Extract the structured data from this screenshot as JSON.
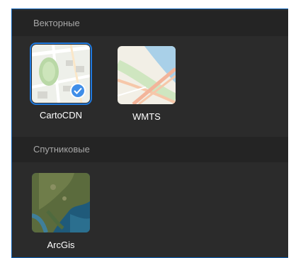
{
  "sections": [
    {
      "title": "Векторные",
      "tiles": [
        {
          "label": "CartoCDN",
          "selected": true,
          "icon": "checkmark-icon"
        },
        {
          "label": "WMTS",
          "selected": false
        }
      ]
    },
    {
      "title": "Спутниковые",
      "tiles": [
        {
          "label": "ArcGis",
          "selected": false
        }
      ]
    }
  ],
  "colors": {
    "panel_bg": "#2b2b2b",
    "header_bg": "#242424",
    "accent": "#3f8ee8"
  }
}
